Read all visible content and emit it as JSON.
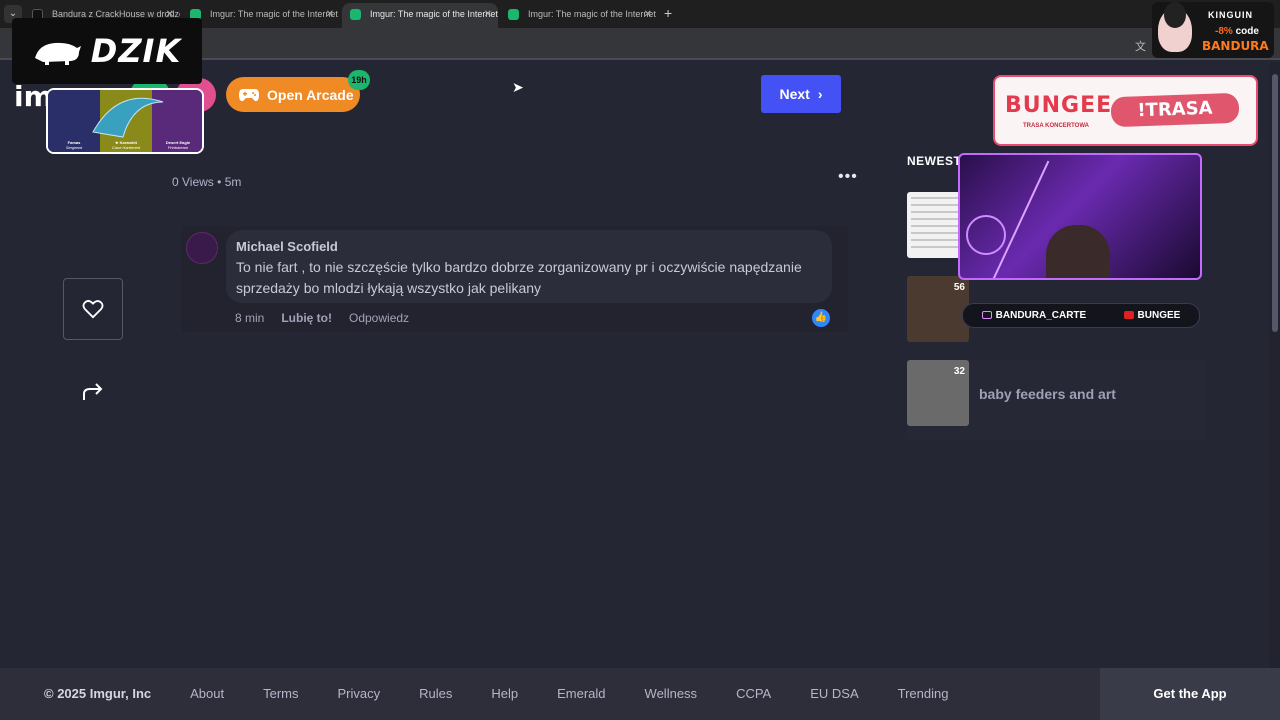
{
  "browser": {
    "tabs": [
      {
        "title": "Bandura z CrackHouse w drodze",
        "active": false,
        "favicon": "tiktok-icon"
      },
      {
        "title": "Imgur: The magic of the Internet",
        "active": false,
        "favicon": "imgur-icon"
      },
      {
        "title": "Imgur: The magic of the Internet",
        "active": true,
        "favicon": "imgur-icon"
      },
      {
        "title": "Imgur: The magic of the Internet",
        "active": false,
        "favicon": "imgur-icon"
      }
    ]
  },
  "overlays": {
    "dzik_logo": "DZIK",
    "kinguin_brand": "KINGUIN",
    "kinguin_discount": "-8%",
    "kinguin_code_word": "code",
    "kinguin_code": "BANDURA",
    "socials": {
      "instagram": "BANDURA_CARTE",
      "youtube": "BUNGEE"
    }
  },
  "header": {
    "logo": "imgur",
    "arcade_label": "Open Arcade",
    "arcade_badge": "19h",
    "arcade_card_items": [
      {
        "name": "Famas",
        "sub": "Sergeant"
      },
      {
        "name": "★ Karambit",
        "sub": "Case Hardened"
      },
      {
        "name": "Desert Eagle",
        "sub": "Printstream"
      }
    ],
    "next_label": "Next"
  },
  "post": {
    "views": "0 Views",
    "age": "5m"
  },
  "comment": {
    "author": "Michael Scofield",
    "text": "To nie fart , to nie szczęście tylko bardzo dobrze zorganizowany pr i oczywiście napędzanie sprzedaży bo mlodzi łykają wszystko jak pelikany",
    "time": "8 min",
    "like_label": "Lubię to!",
    "reply_label": "Odpowiedz"
  },
  "sidebar": {
    "ad": {
      "brand": "BUNGEE",
      "sub": "TRASA KONCERTOWA",
      "tour": "!TRASA"
    },
    "newest_label": "NEWEST",
    "items": [
      {
        "count": "",
        "title": ""
      },
      {
        "count": "56",
        "title": ""
      },
      {
        "count": "32",
        "title": "baby feeders and art"
      }
    ]
  },
  "footer": {
    "copyright": "© 2025 Imgur, Inc",
    "links": [
      "About",
      "Terms",
      "Privacy",
      "Rules",
      "Help",
      "Emerald",
      "Wellness",
      "CCPA",
      "EU DSA",
      "Trending"
    ],
    "get_app": "Get the App"
  },
  "colors": {
    "page_bg": "#252634",
    "next_button": "#4452f5",
    "arcade_button": "#f08a24",
    "imgur_green": "#1bb76e",
    "like_blue": "#2d88ff"
  }
}
